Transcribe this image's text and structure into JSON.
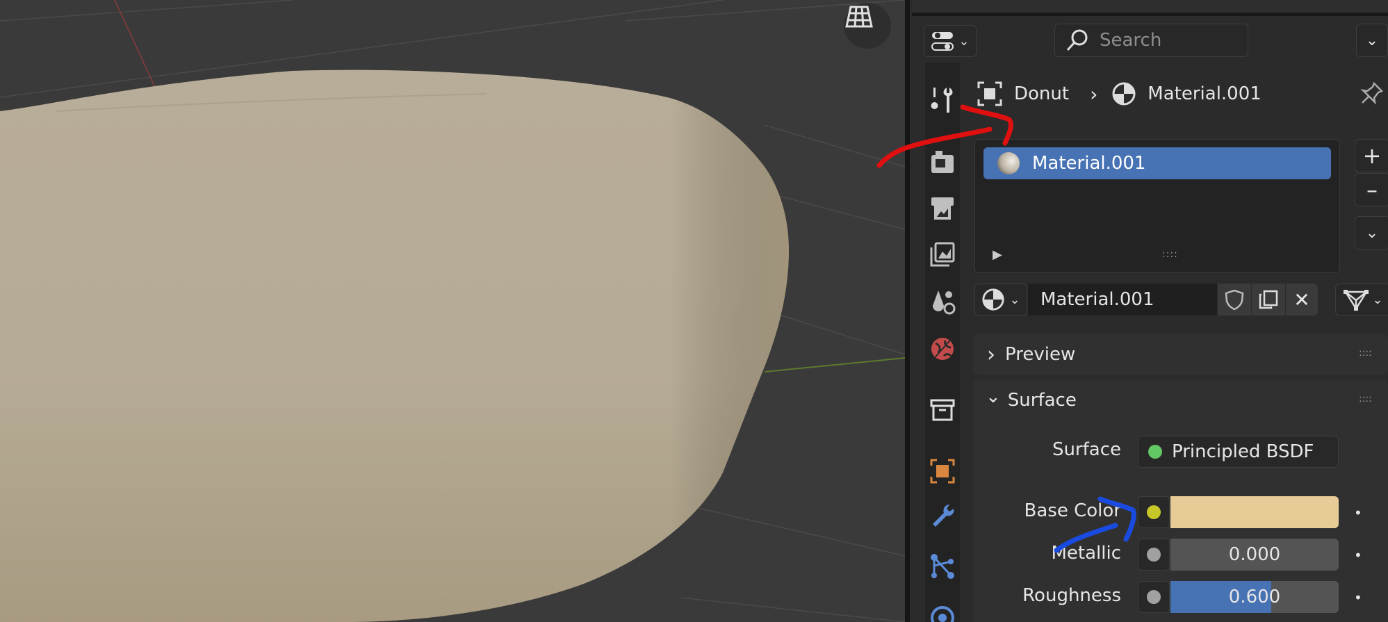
{
  "viewport": {
    "object_color": "#bfb29a"
  },
  "header": {
    "search_placeholder": "Search",
    "breadcrumb_object": "Donut",
    "breadcrumb_material": "Material.001"
  },
  "tabs": [
    {
      "name": "tool-icon"
    },
    {
      "name": "render-icon"
    },
    {
      "name": "output-icon"
    },
    {
      "name": "view-layer-icon"
    },
    {
      "name": "scene-icon"
    },
    {
      "name": "world-icon"
    },
    {
      "name": "collection-icon"
    },
    {
      "name": "object-icon"
    },
    {
      "name": "modifier-icon"
    },
    {
      "name": "particles-icon"
    },
    {
      "name": "physics-icon"
    }
  ],
  "material_slots": {
    "items": [
      {
        "label": "Material.001"
      }
    ]
  },
  "material_datablock": {
    "name": "Material.001"
  },
  "panels": {
    "preview": {
      "label": "Preview"
    },
    "surface": {
      "label": "Surface",
      "surface_field_label": "Surface",
      "surface_shader": "Principled BSDF",
      "base_color_label": "Base Color",
      "base_color": "#e8cc98",
      "metallic_label": "Metallic",
      "metallic_value": "0.000",
      "roughness_label": "Roughness",
      "roughness_value": "0.600",
      "roughness_fraction": 0.6
    }
  },
  "colors": {
    "accent": "#4772b3",
    "annotation_red": "#e01010",
    "annotation_blue": "#1a4be0"
  }
}
